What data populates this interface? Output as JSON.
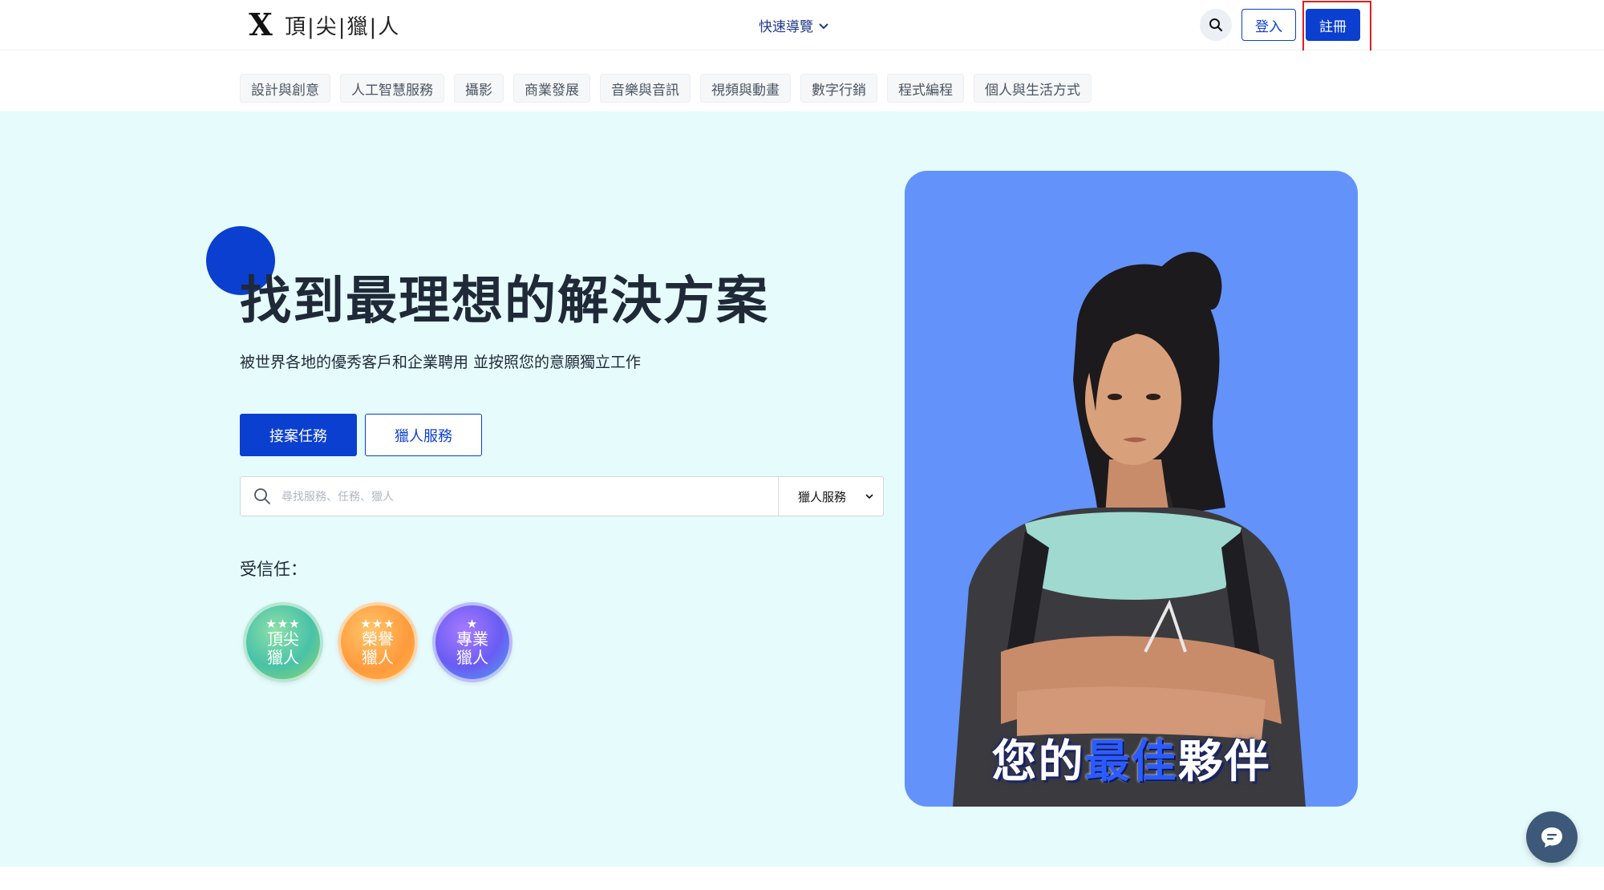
{
  "header": {
    "logo_text": "頂|尖|獵|人",
    "quick_nav_label": "快速導覽",
    "login_label": "登入",
    "signup_label": "註冊"
  },
  "categories": [
    "設計與創意",
    "人工智慧服務",
    "攝影",
    "商業發展",
    "音樂與音訊",
    "視頻與動畫",
    "數字行銷",
    "程式編程",
    "個人與生活方式"
  ],
  "hero": {
    "title": "找到最理想的解決方案",
    "subtitle": "被世界各地的優秀客戶和企業聘用 並按照您的意願獨立工作",
    "primary_button": "接案任務",
    "secondary_button": "獵人服務",
    "search": {
      "placeholder": "尋找服務、任務、獵人",
      "selected_option": "獵人服務"
    },
    "trusted_label": "受信任：",
    "badges": [
      {
        "stars": "★★★",
        "line1": "頂尖",
        "line2": "獵人"
      },
      {
        "stars": "★★★",
        "line1": "榮譽",
        "line2": "獵人"
      },
      {
        "stars": "★",
        "line1": "專業",
        "line2": "獵人"
      }
    ],
    "photo_caption": {
      "part1": "您的",
      "part2": "最佳",
      "part3": "夥伴"
    }
  },
  "colors": {
    "brand_blue": "#0b3fd0",
    "hero_background": "#e6fbfc",
    "photo_background": "#6392fb",
    "annotation_red": "#e11d1d"
  },
  "icons": [
    "search-icon",
    "chevron-down-icon",
    "chat-icon",
    "logo-x-icon"
  ]
}
